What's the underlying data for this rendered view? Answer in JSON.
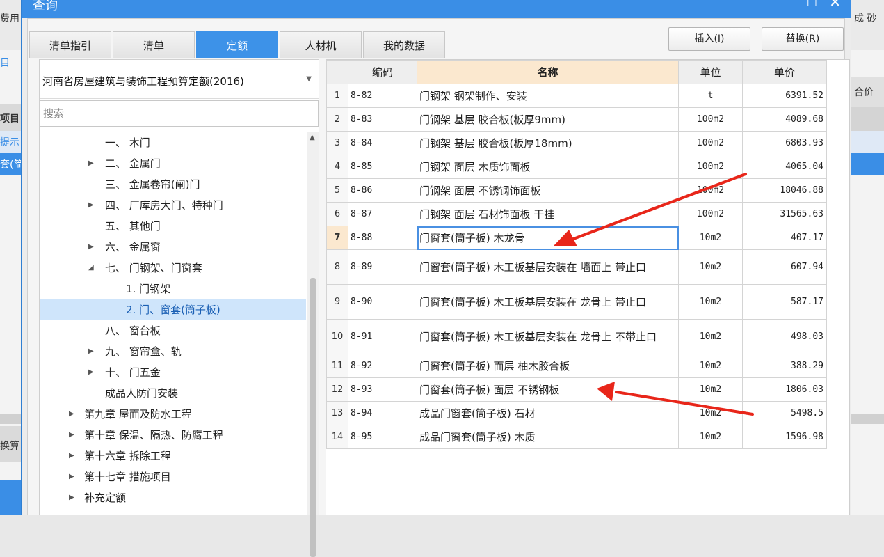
{
  "background": {
    "left_fragments": [
      "费用",
      "目",
      "项目",
      "提示",
      "套(简",
      "换算"
    ],
    "right_fragments": [
      "成 砂",
      "合价"
    ]
  },
  "dialog": {
    "title": "查询",
    "restore_glyph": "□",
    "close_glyph": "✕"
  },
  "tabs": [
    {
      "label": "清单指引"
    },
    {
      "label": "清单"
    },
    {
      "label": "定额"
    },
    {
      "label": "人材机"
    },
    {
      "label": "我的数据"
    }
  ],
  "buttons": {
    "insert": "插入(I)",
    "replace": "替换(R)"
  },
  "library": {
    "selected": "河南省房屋建筑与装饰工程预算定额(2016)"
  },
  "search": {
    "placeholder": "搜索"
  },
  "tree": [
    {
      "label": "一、 木门",
      "arrow": ""
    },
    {
      "label": "二、 金属门",
      "arrow": "▶"
    },
    {
      "label": "三、 金属卷帘(闸)门",
      "arrow": ""
    },
    {
      "label": "四、 厂库房大门、特种门",
      "arrow": "▶"
    },
    {
      "label": "五、 其他门",
      "arrow": ""
    },
    {
      "label": "六、 金属窗",
      "arrow": "▶"
    },
    {
      "label": "七、 门钢架、门窗套",
      "arrow": "◢"
    },
    {
      "label": "1. 门钢架",
      "arrow": ""
    },
    {
      "label": "2. 门、窗套(筒子板)",
      "arrow": ""
    },
    {
      "label": "八、 窗台板",
      "arrow": ""
    },
    {
      "label": "九、 窗帘盒、轨",
      "arrow": "▶"
    },
    {
      "label": "十、 门五金",
      "arrow": "▶"
    },
    {
      "label": "成品人防门安装",
      "arrow": ""
    },
    {
      "label": "第九章 屋面及防水工程",
      "arrow": "▶"
    },
    {
      "label": "第十章 保温、隔热、防腐工程",
      "arrow": "▶"
    },
    {
      "label": "第十六章 拆除工程",
      "arrow": "▶"
    },
    {
      "label": "第十七章 措施项目",
      "arrow": "▶"
    },
    {
      "label": "补充定额",
      "arrow": "▶"
    }
  ],
  "table": {
    "headers": [
      "",
      "编码",
      "名称",
      "单位",
      "单价"
    ],
    "rows": [
      {
        "n": "1",
        "code": "8-82",
        "name": "门钢架 钢架制作、安装",
        "unit": "t",
        "price": "6391.52"
      },
      {
        "n": "2",
        "code": "8-83",
        "name": "门钢架 基层 胶合板(板厚9mm)",
        "unit": "100m2",
        "price": "4089.68"
      },
      {
        "n": "3",
        "code": "8-84",
        "name": "门钢架 基层 胶合板(板厚18mm)",
        "unit": "100m2",
        "price": "6803.93"
      },
      {
        "n": "4",
        "code": "8-85",
        "name": "门钢架 面层 木质饰面板",
        "unit": "100m2",
        "price": "4065.04"
      },
      {
        "n": "5",
        "code": "8-86",
        "name": "门钢架 面层 不锈钢饰面板",
        "unit": "100m2",
        "price": "18046.88"
      },
      {
        "n": "6",
        "code": "8-87",
        "name": "门钢架 面层 石材饰面板 干挂",
        "unit": "100m2",
        "price": "31565.63"
      },
      {
        "n": "7",
        "code": "8-88",
        "name": "门窗套(筒子板) 木龙骨",
        "unit": "10m2",
        "price": "407.17"
      },
      {
        "n": "8",
        "code": "8-89",
        "name": "门窗套(筒子板) 木工板基层安装在 墙面上 带止口",
        "unit": "10m2",
        "price": "607.94"
      },
      {
        "n": "9",
        "code": "8-90",
        "name": "门窗套(筒子板) 木工板基层安装在 龙骨上 带止口",
        "unit": "10m2",
        "price": "587.17"
      },
      {
        "n": "10",
        "code": "8-91",
        "name": "门窗套(筒子板) 木工板基层安装在 龙骨上 不带止口",
        "unit": "10m2",
        "price": "498.03"
      },
      {
        "n": "11",
        "code": "8-92",
        "name": "门窗套(筒子板) 面层 柚木胶合板",
        "unit": "10m2",
        "price": "388.29"
      },
      {
        "n": "12",
        "code": "8-93",
        "name": "门窗套(筒子板) 面层 不锈钢板",
        "unit": "10m2",
        "price": "1806.03"
      },
      {
        "n": "13",
        "code": "8-94",
        "name": "成品门窗套(筒子板) 石材",
        "unit": "10m2",
        "price": "5498.5"
      },
      {
        "n": "14",
        "code": "8-95",
        "name": "成品门窗套(筒子板) 木质",
        "unit": "10m2",
        "price": "1596.98"
      }
    ]
  },
  "colors": {
    "accent": "#3d92e8",
    "selected_row": "#cfe5fb",
    "header_highlight": "#fbe8cf",
    "annotation_arrow": "#e8261a"
  }
}
